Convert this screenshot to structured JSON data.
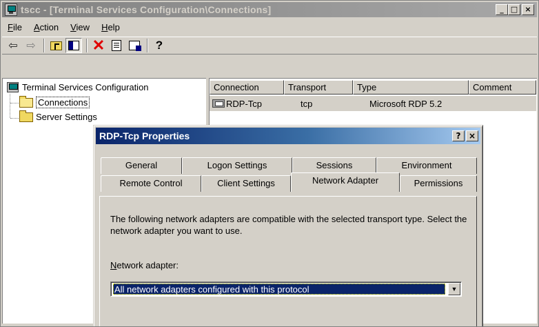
{
  "window": {
    "title": "tscc - [Terminal Services Configuration\\Connections]",
    "buttons": {
      "minimize": "_",
      "maximize": "□",
      "close": "×"
    }
  },
  "menu": [
    {
      "label": "File",
      "accel": "F",
      "rest": "ile"
    },
    {
      "label": "Action",
      "accel": "A",
      "rest": "ction"
    },
    {
      "label": "View",
      "accel": "V",
      "rest": "iew"
    },
    {
      "label": "Help",
      "accel": "H",
      "rest": "elp"
    }
  ],
  "toolbar": {
    "icons": [
      "back-arrow-icon",
      "forward-arrow-icon",
      "up-folder-icon",
      "show-hide-tree-icon",
      "delete-icon",
      "properties-icon",
      "export-list-icon",
      "help-icon"
    ]
  },
  "tree": {
    "root": "Terminal Services Configuration",
    "items": [
      "Connections",
      "Server Settings"
    ],
    "selected": "Connections"
  },
  "list": {
    "columns": [
      "Connection",
      "Transport",
      "Type",
      "Comment"
    ],
    "rows": [
      {
        "connection": "RDP-Tcp",
        "transport": "tcp",
        "type": "Microsoft RDP 5.2",
        "comment": ""
      }
    ]
  },
  "dialog": {
    "title": "RDP-Tcp Properties",
    "buttons": {
      "help": "?",
      "close": "×"
    },
    "tabs_back": [
      "General",
      "Logon Settings",
      "Sessions",
      "Environment"
    ],
    "tabs_front": [
      "Remote Control",
      "Client Settings",
      "Network Adapter",
      "Permissions"
    ],
    "active_tab": "Network Adapter",
    "description": "The following network adapters are compatible with the selected transport type. Select the network adapter you want to use.",
    "adapter_label_accel": "N",
    "adapter_label_rest": "etwork adapter:",
    "adapter_value": "All network adapters configured with this protocol"
  }
}
